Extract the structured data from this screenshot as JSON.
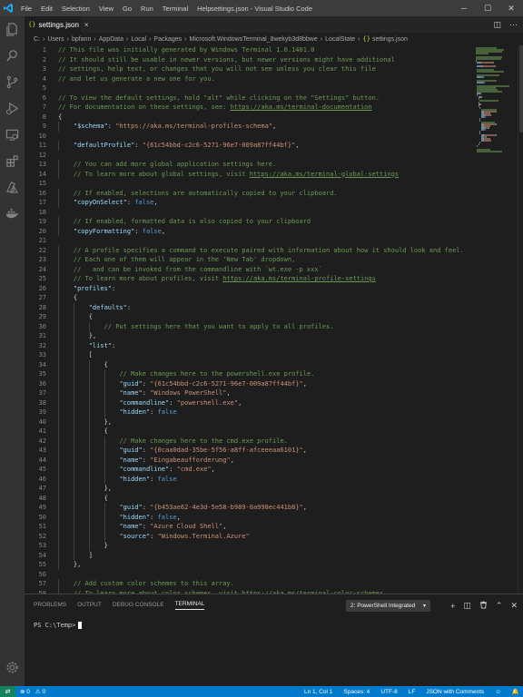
{
  "window": {
    "title": "settings.json - Visual Studio Code",
    "menu": [
      "File",
      "Edit",
      "Selection",
      "View",
      "Go",
      "Run",
      "Terminal",
      "Help"
    ],
    "controls": {
      "minimize": "─",
      "maximize": "☐",
      "close": "✕"
    }
  },
  "activity_bar": {
    "icons": [
      "files-icon",
      "search-icon",
      "source-control-icon",
      "run-debug-icon",
      "remote-explorer-icon",
      "extensions-icon",
      "azure-icon",
      "docker-icon"
    ],
    "bottom_icon": "settings-gear-icon"
  },
  "tab": {
    "icon": "{}",
    "label": "settings.json",
    "close": "×"
  },
  "tab_actions": {
    "split": "◫",
    "more": "···"
  },
  "breadcrumb": [
    "C:",
    "Users",
    "bpfann",
    "AppData",
    "Local",
    "Packages",
    "Microsoft.WindowsTerminal_8wekyb3d8bbwe",
    "LocalState",
    "settings.json"
  ],
  "breadcrumb_file_icon": "{}",
  "editor": {
    "lines": [
      {
        "n": "1",
        "tokens": [
          [
            "c",
            "// This file was initially generated by Windows Terminal 1.0.1401.0"
          ]
        ]
      },
      {
        "n": "2",
        "tokens": [
          [
            "c",
            "// It should still be usable in newer versions, but newer versions might have additional"
          ]
        ]
      },
      {
        "n": "3",
        "tokens": [
          [
            "c",
            "// settings, help text, or changes that you will not see unless you clear this file"
          ]
        ]
      },
      {
        "n": "4",
        "tokens": [
          [
            "c",
            "// and let us generate a new one for you."
          ]
        ]
      },
      {
        "n": "5",
        "tokens": []
      },
      {
        "n": "6",
        "tokens": [
          [
            "c",
            "// To view the default settings, hold \"alt\" while clicking on the \"Settings\" button."
          ]
        ]
      },
      {
        "n": "7",
        "tokens": [
          [
            "c",
            "// For documentation on these settings, see: "
          ],
          [
            "u",
            "https://aka.ms/terminal-documentation"
          ]
        ]
      },
      {
        "n": "8",
        "tokens": [
          [
            "p",
            "{"
          ]
        ]
      },
      {
        "n": "9",
        "tokens": [
          [
            "p",
            "    "
          ],
          [
            "k",
            "\"$schema\""
          ],
          [
            "p",
            ": "
          ],
          [
            "s",
            "\"https://aka.ms/terminal-profiles-schema\""
          ],
          [
            "p",
            ","
          ]
        ]
      },
      {
        "n": "10",
        "tokens": []
      },
      {
        "n": "11",
        "tokens": [
          [
            "p",
            "    "
          ],
          [
            "k",
            "\"defaultProfile\""
          ],
          [
            "p",
            ": "
          ],
          [
            "s",
            "\"{61c54bbd-c2c6-5271-96e7-009a87ff44bf}\""
          ],
          [
            "p",
            ","
          ]
        ]
      },
      {
        "n": "12",
        "tokens": []
      },
      {
        "n": "13",
        "tokens": [
          [
            "p",
            "    "
          ],
          [
            "c",
            "// You can add more global application settings here."
          ]
        ]
      },
      {
        "n": "14",
        "tokens": [
          [
            "p",
            "    "
          ],
          [
            "c",
            "// To learn more about global settings, visit "
          ],
          [
            "u",
            "https://aka.ms/terminal-global-settings"
          ]
        ]
      },
      {
        "n": "15",
        "tokens": []
      },
      {
        "n": "16",
        "tokens": [
          [
            "p",
            "    "
          ],
          [
            "c",
            "// If enabled, selections are automatically copied to your clipboard."
          ]
        ]
      },
      {
        "n": "17",
        "tokens": [
          [
            "p",
            "    "
          ],
          [
            "k",
            "\"copyOnSelect\""
          ],
          [
            "p",
            ": "
          ],
          [
            "b",
            "false"
          ],
          [
            "p",
            ","
          ]
        ]
      },
      {
        "n": "18",
        "tokens": []
      },
      {
        "n": "19",
        "tokens": [
          [
            "p",
            "    "
          ],
          [
            "c",
            "// If enabled, formatted data is also copied to your clipboard"
          ]
        ]
      },
      {
        "n": "20",
        "tokens": [
          [
            "p",
            "    "
          ],
          [
            "k",
            "\"copyFormatting\""
          ],
          [
            "p",
            ": "
          ],
          [
            "b",
            "false"
          ],
          [
            "p",
            ","
          ]
        ]
      },
      {
        "n": "21",
        "tokens": []
      },
      {
        "n": "22",
        "tokens": [
          [
            "p",
            "    "
          ],
          [
            "c",
            "// A profile specifies a command to execute paired with information about how it should look and feel."
          ]
        ]
      },
      {
        "n": "23",
        "tokens": [
          [
            "p",
            "    "
          ],
          [
            "c",
            "// Each one of them will appear in the 'New Tab' dropdown,"
          ]
        ]
      },
      {
        "n": "24",
        "tokens": [
          [
            "p",
            "    "
          ],
          [
            "c",
            "//   and can be invoked from the commandline with `wt.exe -p xxx`"
          ]
        ]
      },
      {
        "n": "25",
        "tokens": [
          [
            "p",
            "    "
          ],
          [
            "c",
            "// To learn more about profiles, visit "
          ],
          [
            "u",
            "https://aka.ms/terminal-profile-settings"
          ]
        ]
      },
      {
        "n": "26",
        "tokens": [
          [
            "p",
            "    "
          ],
          [
            "k",
            "\"profiles\""
          ],
          [
            "p",
            ":"
          ]
        ]
      },
      {
        "n": "27",
        "tokens": [
          [
            "p",
            "    {"
          ]
        ]
      },
      {
        "n": "28",
        "tokens": [
          [
            "p",
            "        "
          ],
          [
            "k",
            "\"defaults\""
          ],
          [
            "p",
            ":"
          ]
        ]
      },
      {
        "n": "29",
        "tokens": [
          [
            "p",
            "        {"
          ]
        ]
      },
      {
        "n": "30",
        "tokens": [
          [
            "p",
            "            "
          ],
          [
            "c",
            "// Put settings here that you want to apply to all profiles."
          ]
        ]
      },
      {
        "n": "31",
        "tokens": [
          [
            "p",
            "        },"
          ]
        ]
      },
      {
        "n": "32",
        "tokens": [
          [
            "p",
            "        "
          ],
          [
            "k",
            "\"list\""
          ],
          [
            "p",
            ":"
          ]
        ]
      },
      {
        "n": "33",
        "tokens": [
          [
            "p",
            "        ["
          ]
        ]
      },
      {
        "n": "34",
        "tokens": [
          [
            "p",
            "            {"
          ]
        ]
      },
      {
        "n": "35",
        "tokens": [
          [
            "p",
            "                "
          ],
          [
            "c",
            "// Make changes here to the powershell.exe profile."
          ]
        ]
      },
      {
        "n": "36",
        "tokens": [
          [
            "p",
            "                "
          ],
          [
            "k",
            "\"guid\""
          ],
          [
            "p",
            ": "
          ],
          [
            "s",
            "\"{61c54bbd-c2c6-5271-96e7-009a87ff44bf}\""
          ],
          [
            "p",
            ","
          ]
        ]
      },
      {
        "n": "37",
        "tokens": [
          [
            "p",
            "                "
          ],
          [
            "k",
            "\"name\""
          ],
          [
            "p",
            ": "
          ],
          [
            "s",
            "\"Windows PowerShell\""
          ],
          [
            "p",
            ","
          ]
        ]
      },
      {
        "n": "38",
        "tokens": [
          [
            "p",
            "                "
          ],
          [
            "k",
            "\"commandline\""
          ],
          [
            "p",
            ": "
          ],
          [
            "s",
            "\"powershell.exe\""
          ],
          [
            "p",
            ","
          ]
        ]
      },
      {
        "n": "39",
        "tokens": [
          [
            "p",
            "                "
          ],
          [
            "k",
            "\"hidden\""
          ],
          [
            "p",
            ": "
          ],
          [
            "b",
            "false"
          ]
        ]
      },
      {
        "n": "40",
        "tokens": [
          [
            "p",
            "            },"
          ]
        ]
      },
      {
        "n": "41",
        "tokens": [
          [
            "p",
            "            {"
          ]
        ]
      },
      {
        "n": "42",
        "tokens": [
          [
            "p",
            "                "
          ],
          [
            "c",
            "// Make changes here to the cmd.exe profile."
          ]
        ]
      },
      {
        "n": "43",
        "tokens": [
          [
            "p",
            "                "
          ],
          [
            "k",
            "\"guid\""
          ],
          [
            "p",
            ": "
          ],
          [
            "s",
            "\"{0caa0dad-35be-5f56-a8ff-afceeeaa6101}\""
          ],
          [
            "p",
            ","
          ]
        ]
      },
      {
        "n": "44",
        "tokens": [
          [
            "p",
            "                "
          ],
          [
            "k",
            "\"name\""
          ],
          [
            "p",
            ": "
          ],
          [
            "s",
            "\"Eingabeaufforderung\""
          ],
          [
            "p",
            ","
          ]
        ]
      },
      {
        "n": "45",
        "tokens": [
          [
            "p",
            "                "
          ],
          [
            "k",
            "\"commandline\""
          ],
          [
            "p",
            ": "
          ],
          [
            "s",
            "\"cmd.exe\""
          ],
          [
            "p",
            ","
          ]
        ]
      },
      {
        "n": "46",
        "tokens": [
          [
            "p",
            "                "
          ],
          [
            "k",
            "\"hidden\""
          ],
          [
            "p",
            ": "
          ],
          [
            "b",
            "false"
          ]
        ]
      },
      {
        "n": "47",
        "tokens": [
          [
            "p",
            "            },"
          ]
        ]
      },
      {
        "n": "48",
        "tokens": [
          [
            "p",
            "            {"
          ]
        ]
      },
      {
        "n": "49",
        "tokens": [
          [
            "p",
            "                "
          ],
          [
            "k",
            "\"guid\""
          ],
          [
            "p",
            ": "
          ],
          [
            "s",
            "\"{b453ae62-4e3d-5e58-b989-0a998ec441b8}\""
          ],
          [
            "p",
            ","
          ]
        ]
      },
      {
        "n": "50",
        "tokens": [
          [
            "p",
            "                "
          ],
          [
            "k",
            "\"hidden\""
          ],
          [
            "p",
            ": "
          ],
          [
            "b",
            "false"
          ],
          [
            "p",
            ","
          ]
        ]
      },
      {
        "n": "51",
        "tokens": [
          [
            "p",
            "                "
          ],
          [
            "k",
            "\"name\""
          ],
          [
            "p",
            ": "
          ],
          [
            "s",
            "\"Azure Cloud Shell\""
          ],
          [
            "p",
            ","
          ]
        ]
      },
      {
        "n": "52",
        "tokens": [
          [
            "p",
            "                "
          ],
          [
            "k",
            "\"source\""
          ],
          [
            "p",
            ": "
          ],
          [
            "s",
            "\"Windows.Terminal.Azure\""
          ]
        ]
      },
      {
        "n": "53",
        "tokens": [
          [
            "p",
            "            }"
          ]
        ]
      },
      {
        "n": "54",
        "tokens": [
          [
            "p",
            "        ]"
          ]
        ]
      },
      {
        "n": "55",
        "tokens": [
          [
            "p",
            "    },"
          ]
        ]
      },
      {
        "n": "56",
        "tokens": []
      },
      {
        "n": "57",
        "tokens": [
          [
            "p",
            "    "
          ],
          [
            "c",
            "// Add custom color schemes to this array."
          ]
        ]
      },
      {
        "n": "58",
        "tokens": [
          [
            "p",
            "    "
          ],
          [
            "c",
            "// To learn more about color schemes, visit "
          ],
          [
            "u",
            "https://aka.ms/terminal-color-schemes"
          ]
        ]
      }
    ]
  },
  "panel": {
    "tabs": [
      "PROBLEMS",
      "OUTPUT",
      "DEBUG CONSOLE",
      "TERMINAL"
    ],
    "active_tab": "TERMINAL",
    "terminal_select": "2: PowerShell Integrated",
    "actions": {
      "new": "+",
      "split": "◫",
      "kill": "🗑",
      "maximize": "⌃",
      "close": "✕"
    },
    "prompt": "PS C:\\Temp>"
  },
  "statusbar": {
    "remote": "⇄",
    "errors": "⊗ 0",
    "warnings": "⚠ 0",
    "position": "Ln 1, Col 1",
    "spaces": "Spaces: 4",
    "encoding": "UTF-8",
    "eol": "LF",
    "language": "JSON with Comments",
    "feedback": "☺",
    "notifications": "🔔"
  },
  "colors": {
    "titlebar": "#3c3c3c",
    "activitybar": "#333333",
    "editor_bg": "#1e1e1e",
    "statusbar": "#007acc",
    "comment": "#6a9955",
    "string": "#ce9178",
    "key": "#9cdcfe",
    "boolean": "#569cd6"
  }
}
